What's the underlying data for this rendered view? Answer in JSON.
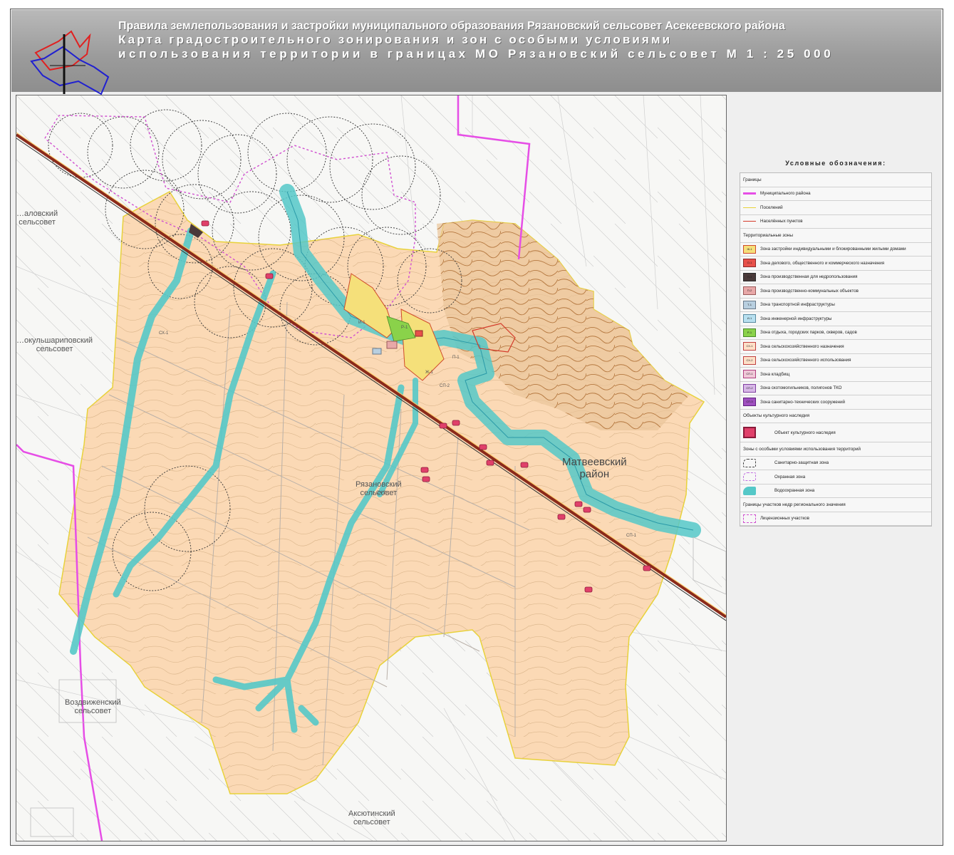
{
  "title": {
    "line1": "Правила землепользования и застройки муниципального образования Рязановский сельсовет Асекеевского района",
    "line2": "Карта градостроительного зонирования и зон с особыми условиями",
    "line3": "использования территории в границах МО Рязановский сельсовет М 1 : 25 000"
  },
  "map": {
    "neighbors": [
      {
        "id": "shalovsky",
        "text": "…аловский\nсельсовет"
      },
      {
        "id": "tokulshari",
        "text": "…окульшариповский\nсельсовет"
      },
      {
        "id": "vozdvizh",
        "text": "Воздвиженский\nсельсовет"
      },
      {
        "id": "aksyutin",
        "text": "Аксютинский\nсельсовет"
      },
      {
        "id": "matveev",
        "text": "Матвеевский\nрайон"
      },
      {
        "id": "ryazanov",
        "text": "Рязановский\nсельсовет"
      }
    ],
    "zone_codes": [
      "СХ-2",
      "СХ-1",
      "СП-2",
      "СП-1",
      "Ж-1",
      "П-1",
      "И-1",
      "Р-1"
    ]
  },
  "legend": {
    "title": "Условные обозначения:",
    "rows": [
      {
        "kind": "section",
        "text": "Границы"
      },
      {
        "kind": "line",
        "color": "#e64ee6",
        "width": 3,
        "text": "Муниципального района"
      },
      {
        "kind": "line",
        "color": "#e8d23a",
        "width": 1.5,
        "text": "Поселений"
      },
      {
        "kind": "line",
        "color": "#d43a2a",
        "width": 1.5,
        "text": "Населённых пунктов"
      },
      {
        "kind": "section",
        "text": "Территориальные зоны"
      },
      {
        "kind": "box",
        "fill": "#f5e07a",
        "border": "#d04a2a",
        "code": "Ж-1",
        "text": "Зона застройки индивидуальными и блокированными жилыми домами"
      },
      {
        "kind": "box",
        "fill": "#e8504a",
        "border": "#8a2a2a",
        "code": "О-1",
        "text": "Зона делового, общественного и коммерческого назначения"
      },
      {
        "kind": "box",
        "fill": "#4a3a3a",
        "border": "#2a2a2a",
        "code": "П-3",
        "text": "Зона производственная для недропользования"
      },
      {
        "kind": "box",
        "fill": "#e8a8a8",
        "border": "#9a5a5a",
        "code": "П-2",
        "text": "Зона производственно-коммунальных объектов"
      },
      {
        "kind": "box",
        "fill": "#b8cfe0",
        "border": "#6a7a8a",
        "code": "Т-1",
        "text": "Зона транспортной инфраструктуры"
      },
      {
        "kind": "box",
        "fill": "#b8e0f0",
        "border": "#5a8aa0",
        "code": "И-1",
        "text": "Зона инженерной инфраструктуры"
      },
      {
        "kind": "box",
        "fill": "#8ad24a",
        "border": "#4a8a2a",
        "code": "Р-1",
        "text": "Зона отдыха, городских парков, скверов, садов"
      },
      {
        "kind": "box",
        "fill": "#ffe0c8",
        "border": "#c04040",
        "code": "СХ-1",
        "text": "Зона сельскохозяйственного назначения"
      },
      {
        "kind": "box",
        "fill": "#fde0c8",
        "border": "#c04040",
        "code": "СХ-2",
        "text": "Зона сельскохозяйственного использования"
      },
      {
        "kind": "box",
        "fill": "#f0c8d8",
        "border": "#b04080",
        "code": "СП-1",
        "text": "Зона кладбищ"
      },
      {
        "kind": "box",
        "fill": "#d8b8e8",
        "border": "#8040a0",
        "code": "СП-2",
        "text": "Зона скотомогильников, полигонов ТКО"
      },
      {
        "kind": "box",
        "fill": "#a050c0",
        "border": "#602080",
        "code": "СП-3",
        "text": "Зона санитарно-технических сооружений"
      },
      {
        "kind": "section",
        "text": "Объекты культурного наследия"
      },
      {
        "kind": "heritage",
        "text": "Объект культурного наследия"
      },
      {
        "kind": "section",
        "text": "Зоны с особыми условиями использования территорий"
      },
      {
        "kind": "dashed",
        "color": "#444",
        "text": "Санитарно-защитная зона"
      },
      {
        "kind": "dashed",
        "color": "#c070e0",
        "text": "Охранная зона"
      },
      {
        "kind": "water",
        "text": "Водоохранная зона"
      },
      {
        "kind": "section",
        "text": "Границы участков недр регионального значения"
      },
      {
        "kind": "licence",
        "text": "Лицензионных участков"
      }
    ]
  },
  "colors": {
    "agri": "#fbd9b5",
    "water": "#55c8c8",
    "road": "#8b2a1a",
    "district": "#e64ee6",
    "settlement": "#e8d23a",
    "relief": "#d4a878"
  }
}
